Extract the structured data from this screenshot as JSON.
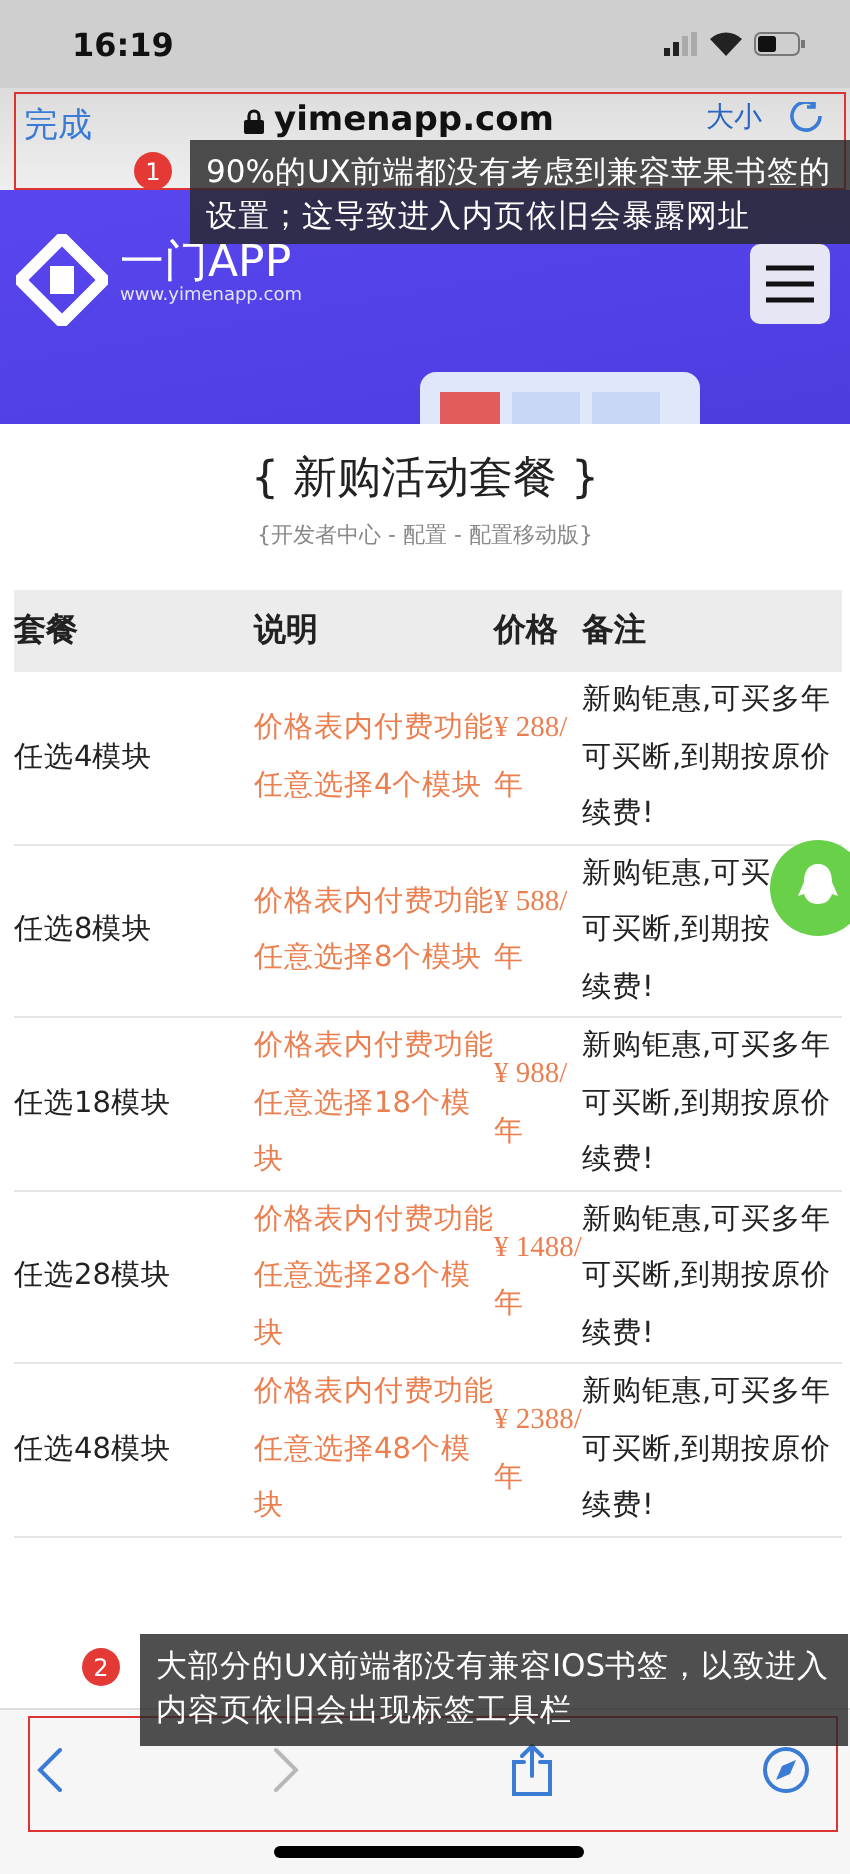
{
  "status_bar": {
    "time": "16:19"
  },
  "browser_bar": {
    "done": "完成",
    "url": "yimenapp.com",
    "text_size": "大小"
  },
  "banner": {
    "logo_name": "一门APP",
    "logo_url": "www.yimenapp.com"
  },
  "section": {
    "title": "{ 新购活动套餐 }",
    "subtitle": "{开发者中心 - 配置 - 配置移动版}"
  },
  "table": {
    "columns": [
      "套餐",
      "说明",
      "价格",
      "备注"
    ],
    "rows": [
      {
        "package": "任选4模块",
        "description": "价格表内付费功能任意选择4个模块",
        "price": "¥ 288/年",
        "note": "新购钜惠,可买多年可买断,到期按原价续费!"
      },
      {
        "package": "任选8模块",
        "description": "价格表内付费功能任意选择8个模块",
        "price": "¥ 588/年",
        "note_lines": [
          "新购钜惠,可买",
          "可买断,到期按",
          "续费!"
        ]
      },
      {
        "package": "任选18模块",
        "description": "价格表内付费功能任意选择18个模块",
        "price": "¥ 988/年",
        "note": "新购钜惠,可买多年可买断,到期按原价续费!"
      },
      {
        "package": "任选28模块",
        "description": "价格表内付费功能任意选择28个模块",
        "price": "¥ 1488/年",
        "note": "新购钜惠,可买多年可买断,到期按原价续费!"
      },
      {
        "package": "任选48模块",
        "description": "价格表内付费功能任意选择48个模块",
        "price": "¥ 2388/年",
        "note": "新购钜惠,可买多年可买断,到期按原价续费!"
      }
    ]
  },
  "toolbar": [
    {
      "kind": "back",
      "disabled": false
    },
    {
      "kind": "forward",
      "disabled": true
    },
    {
      "kind": "share",
      "disabled": false
    },
    {
      "kind": "compass",
      "disabled": false
    }
  ],
  "annotations": [
    {
      "number": "1",
      "text": "90%的UX前端都没有考虑到兼容苹果书签的设置；这导致进入内页依旧会暴露网址"
    },
    {
      "number": "2",
      "text": "大部分的UX前端都没有兼容IOS书签，以致进入内容页依旧会出现标签工具栏"
    }
  ]
}
